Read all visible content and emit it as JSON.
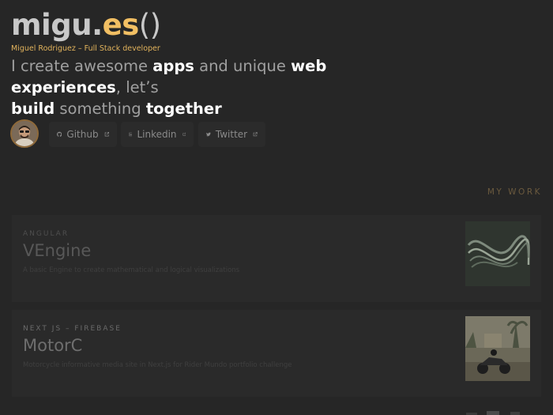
{
  "header": {
    "logo_pre": "migu.",
    "logo_mid": "es",
    "logo_post": "()",
    "subtitle": "Miguel Rodriguez – Full Stack developer"
  },
  "intro": {
    "p1": "I create awesome ",
    "apps": "apps",
    "p2": " and unique ",
    "web": "web experiences",
    "p3": ", let’s ",
    "build": "build",
    "p4": " something ",
    "together": "together"
  },
  "social": [
    {
      "label": "Github",
      "icon": "github-icon"
    },
    {
      "label": "Linkedin",
      "icon": "linkedin-icon"
    },
    {
      "label": "Twitter",
      "icon": "twitter-icon"
    }
  ],
  "work": {
    "section_title": "MY WORK",
    "items": [
      {
        "tags": "ANGULAR",
        "title": "VEngine",
        "description": "A basic Engine to create mathematical and logical visualizations"
      },
      {
        "tags": "NEXT JS – FIREBASE",
        "title": "MotorC",
        "description": "Motorcycle informative media site in Next.js for Rider Mundo portfolio challenge"
      }
    ]
  },
  "colors": {
    "background": "#262626",
    "accent": "#f2bf63",
    "text_strong": "#ffffff",
    "text_muted": "#a0a0a0"
  }
}
